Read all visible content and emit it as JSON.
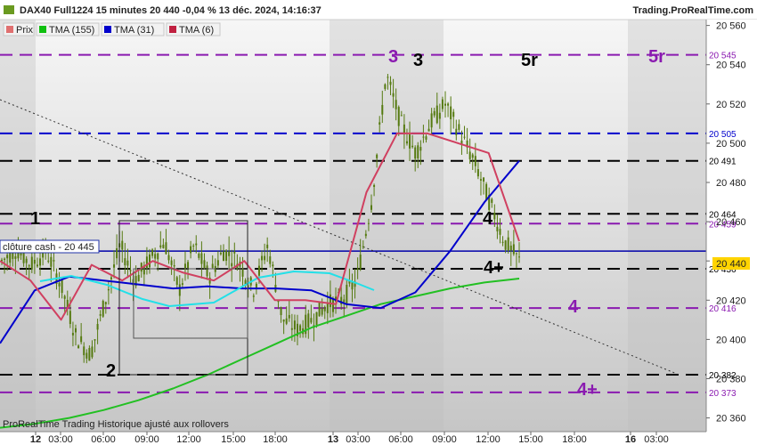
{
  "header": {
    "title": "DAX40 Full1224 15 minutes 20 440 -0,04 % 13 déc. 2024, 14:16:37",
    "site": "Trading.ProRealTime.com",
    "footer": "ProRealTime Trading  Historique ajusté aux rollovers"
  },
  "legend": [
    {
      "label": "Prix",
      "color": "#e07070"
    },
    {
      "label": "TMA (155)",
      "color": "#10c010"
    },
    {
      "label": "TMA (31)",
      "color": "#0000cc"
    },
    {
      "label": "TMA (6)",
      "color": "#c02040"
    }
  ],
  "close_box": {
    "label": "clôture cash -  20 445"
  },
  "last_price_label": "20 440",
  "colors": {
    "candle": "#557a10",
    "tma155": "#22c022",
    "tma31": "#0000cc",
    "tma6": "#d04060",
    "purple": "#8a1ab0",
    "blue_level": "#0000cc",
    "black_level": "#000000",
    "close_line": "#0000aa"
  },
  "chart_data": {
    "type": "candlestick",
    "x_axis": [
      "12",
      "03:00",
      "06:00",
      "09:00",
      "12:00",
      "15:00",
      "18:00",
      "13",
      "03:00",
      "06:00",
      "09:00",
      "12:00",
      "15:00",
      "18:00",
      "16",
      "03:00"
    ],
    "y_ticks": [
      "20 560",
      "20 540",
      "20 520",
      "20 500",
      "20 480",
      "20 460",
      "20 440",
      "20 420",
      "20 400",
      "20 380",
      "20 360"
    ],
    "ylim": [
      20353,
      20563
    ],
    "levels": [
      {
        "value": 20545,
        "label": "20 545",
        "color": "purple"
      },
      {
        "value": 20505,
        "label": "20 505",
        "color": "blue"
      },
      {
        "value": 20491,
        "label": "20 491",
        "color": "black"
      },
      {
        "value": 20464,
        "label": "20 464",
        "color": "black"
      },
      {
        "value": 20459,
        "label": "20 459",
        "color": "purple"
      },
      {
        "value": 20436,
        "label": "20 436",
        "color": "black"
      },
      {
        "value": 20416,
        "label": "20 416",
        "color": "purple"
      },
      {
        "value": 20382,
        "label": "20 382",
        "color": "black"
      },
      {
        "value": 20373,
        "label": "20 373",
        "color": "purple"
      }
    ],
    "close_cash": 20445,
    "last_price": 20440,
    "annotations": [
      {
        "text": "1",
        "color": "black"
      },
      {
        "text": "2",
        "color": "black"
      },
      {
        "text": "3",
        "color": "purple"
      },
      {
        "text": "3",
        "color": "black"
      },
      {
        "text": "5r",
        "color": "black"
      },
      {
        "text": "5r",
        "color": "purple"
      },
      {
        "text": "4",
        "color": "black"
      },
      {
        "text": "4+",
        "color": "black"
      },
      {
        "text": "4",
        "color": "purple"
      },
      {
        "text": "4+",
        "color": "purple"
      }
    ],
    "tma155": [
      20355,
      20357,
      20360,
      20364,
      20369,
      20375,
      20382,
      20390,
      20398,
      20406,
      20412,
      20418,
      20422,
      20426,
      20429,
      20431
    ],
    "tma31": [
      20398,
      20425,
      20432,
      20430,
      20428,
      20426,
      20427,
      20426,
      20426,
      20425,
      20418,
      20416,
      20424,
      20445,
      20470,
      20491
    ],
    "tma6": [
      20440,
      20430,
      20410,
      20438,
      20430,
      20440,
      20434,
      20430,
      20440,
      20420,
      20420,
      20418,
      20475,
      20505,
      20505,
      20500,
      20495,
      20450
    ],
    "price_path": [
      20440,
      20446,
      20438,
      20445,
      20428,
      20402,
      20392,
      20420,
      20448,
      20430,
      20440,
      20450,
      20425,
      20448,
      20432,
      20445,
      20440,
      20425,
      20448,
      20410,
      20405,
      20410,
      20418,
      20420,
      20430,
      20470,
      20535,
      20510,
      20495,
      20510,
      20520,
      20505,
      20490,
      20470,
      20450,
      20440
    ]
  }
}
